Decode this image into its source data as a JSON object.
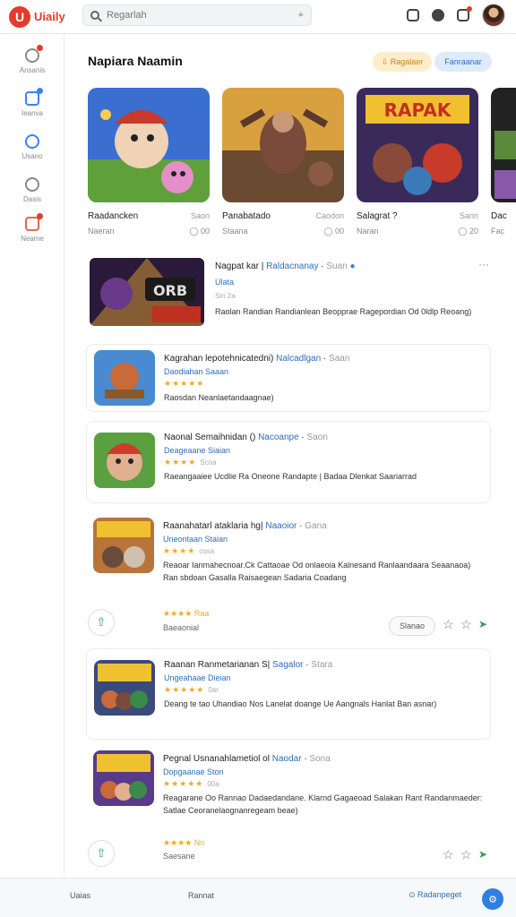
{
  "brand": {
    "name": "Uiaily",
    "logo_glyph": "U",
    "color": "#e43b2c"
  },
  "search": {
    "placeholder": "Regarlah"
  },
  "sidebar": {
    "items": [
      {
        "label": "Ansanis",
        "icon": "clock-icon"
      },
      {
        "label": "Ieanva",
        "icon": "store-icon"
      },
      {
        "label": "Usano",
        "icon": "grid-icon"
      },
      {
        "label": "Dasis",
        "icon": "cloud-icon"
      },
      {
        "label": "Neame",
        "icon": "message-icon"
      }
    ]
  },
  "main": {
    "title": "Napiara Naamin",
    "update_label": "Ragalaer",
    "filter_label": "Fanraanar"
  },
  "cards": [
    {
      "name": "Raadancken",
      "tag": "Saon",
      "sub": "Naeran",
      "count": "00"
    },
    {
      "name": "Panabatado",
      "tag": "Caodon",
      "sub": "Staana",
      "count": "00"
    },
    {
      "name": "Salagrat ?",
      "tag": "Sann",
      "sub": "Naran",
      "count": "20"
    },
    {
      "name": "Dac",
      "tag": "",
      "sub": "Fac",
      "count": ""
    }
  ],
  "featured": {
    "title": "Nagpat kar",
    "link": "Raldacnanay",
    "muted": "Suan",
    "sub": "Ulata",
    "meta": "Sin 2a",
    "desc": "Raolan Randian Randianlean Beopprae Ragepordian Od 0ldlp Reoang)"
  },
  "items": [
    {
      "title": "Kagrahan lepotehnicatedni)",
      "link": "Nalcadlgan",
      "muted": "Saan",
      "sub": "Daodiahan Saaan",
      "rating_stars": "★★★★★",
      "rating_count": "",
      "desc": "Raosdan Neanlaetandaagnae)"
    },
    {
      "title": "Naonal Semaihnidan ()",
      "link": "Nacoanpe",
      "muted": "Saon",
      "sub": "Deageaane Siaian",
      "rating_stars": "★★★★",
      "rating_count": "Scoa",
      "desc": "Raeangaaiee Ucdlie Ra Oneone Randapte | Badaa Dlenkat Saariarrad"
    },
    {
      "title": "Raanahatarl ataklaria hg|",
      "link": "Naaoior",
      "muted": "Gana",
      "sub": "Uneontaan Staian",
      "rating_stars": "★★★★",
      "rating_count": "cosa",
      "desc": "Reaoar Ianmahecnoar.Ck Cattaoae Od onlaeoia Kalnesand Ranlaandaara Seaanaoa) Ran sbdoan Gasalla Raisaegean Sadaria Coadang"
    },
    {
      "title": "Raanan Ranmetarianan S|",
      "link": "Sagalor",
      "muted": "Stara",
      "sub": "Ungeahaae Dieian",
      "rating_stars": "★★★★★",
      "rating_count": "0ar",
      "desc": "Deang te tao Uhandiao Nos Lanelat doange Ue Aangnals Hanlat Ban asnar)"
    },
    {
      "title": "Pegnal Usnanahlametiol ol",
      "link": "Naodar",
      "muted": "Sona",
      "sub": "Dopgaanae Ston",
      "rating_stars": "★★★★★",
      "rating_count": "00a",
      "desc": "Reagarane Oo Rannao Dadaedandane. Klarnd Gagaeoad Salakan Rant Randanmaeder: Satlae Ceoranelaognanregeam beae)"
    }
  ],
  "actions": [
    {
      "label": "Baeaonial",
      "rating": "★★★★ Raa",
      "button": "Slanao"
    },
    {
      "label": "Saesane",
      "rating": "★★★★ Nn",
      "button": ""
    }
  ],
  "footer": {
    "left": "Uaias",
    "middle": "Rannat",
    "right": "Radanpeget"
  }
}
